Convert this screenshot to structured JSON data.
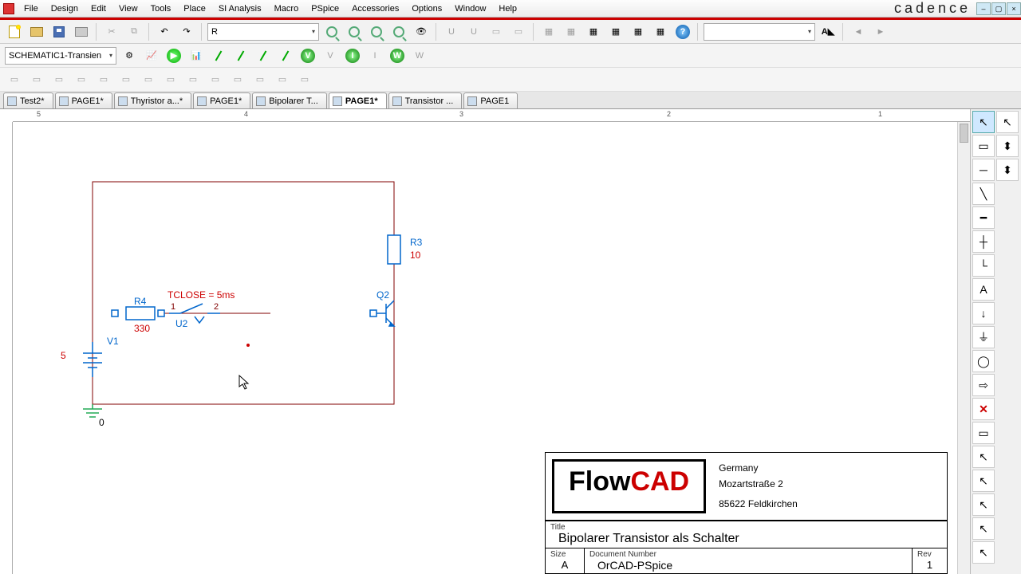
{
  "menu": {
    "items": [
      "File",
      "Design",
      "Edit",
      "View",
      "Tools",
      "Place",
      "SI Analysis",
      "Macro",
      "PSpice",
      "Accessories",
      "Options",
      "Window",
      "Help"
    ]
  },
  "logo": "cadence",
  "part_combo": "R",
  "sim_combo": "SCHEMATIC1-Transien",
  "tabs": [
    {
      "label": "Test2*"
    },
    {
      "label": "PAGE1*"
    },
    {
      "label": "Thyristor a...*"
    },
    {
      "label": "PAGE1*"
    },
    {
      "label": "Bipolarer T..."
    },
    {
      "label": "PAGE1*",
      "active": true
    },
    {
      "label": "Transistor ..."
    },
    {
      "label": "PAGE1"
    }
  ],
  "ruler": {
    "marks": [
      "5",
      "4",
      "3",
      "2",
      "1"
    ]
  },
  "schematic": {
    "r4": {
      "name": "R4",
      "value": "330"
    },
    "r3": {
      "name": "R3",
      "value": "10"
    },
    "q2": "Q2",
    "v1": {
      "name": "V1",
      "value": "5"
    },
    "u2": {
      "name": "U2",
      "tclose": "TCLOSE = 5ms",
      "n1": "1",
      "n2": "2"
    },
    "gnd": "0"
  },
  "titleblock": {
    "company": {
      "a": "Flow",
      "b": "CAD"
    },
    "address": [
      "Germany",
      "Mozartstraße 2",
      "85622 Feldkirchen"
    ],
    "title_lbl": "Title",
    "title": "Bipolarer Transistor als Schalter",
    "size_lbl": "Size",
    "size": "A",
    "doc_lbl": "Document  Number",
    "doc": "OrCAD-PSpice",
    "rev_lbl": "Rev",
    "rev": "1"
  }
}
